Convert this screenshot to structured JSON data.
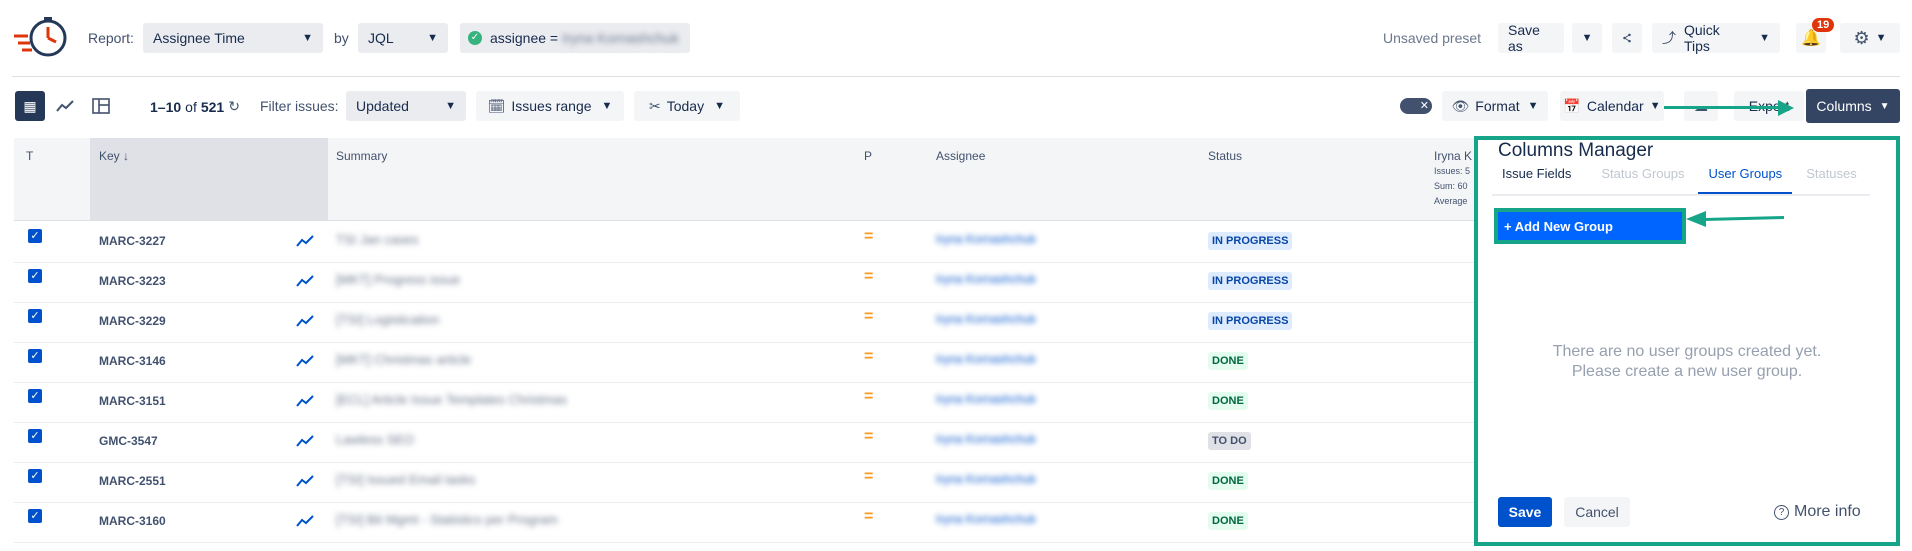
{
  "header": {
    "report_label": "Report:",
    "report_value": "Assignee Time",
    "by_label": "by",
    "by_value": "JQL",
    "filter_text": "assignee =",
    "filter_value": "Iryna Kornashchuk",
    "unsaved_preset": "Unsaved preset",
    "save_as": "Save as",
    "quick_tips": "Quick Tips",
    "notification_count": "19"
  },
  "toolbar": {
    "range_text": "1–10",
    "of_text": "of",
    "total": "521",
    "filter_issues_label": "Filter issues:",
    "filter_value": "Updated",
    "issues_range": "Issues range",
    "today": "Today",
    "format": "Format",
    "calendar": "Calendar",
    "export": "Export",
    "columns": "Columns"
  },
  "table": {
    "headers": {
      "t": "T",
      "key": "Key",
      "summary": "Summary",
      "p": "P",
      "assignee": "Assignee",
      "status": "Status"
    },
    "extra_col": {
      "name": "Iryna K",
      "issues": "Issues: 5",
      "sum": "Sum: 60",
      "average": "Average"
    },
    "rows": [
      {
        "key": "MARC-3227",
        "summary": "TSI Jan cases",
        "assignee": "Iryna Kornashchuk",
        "status": "IN PROGRESS",
        "status_kind": "prog"
      },
      {
        "key": "MARC-3223",
        "summary": "[MKT] Progress issue",
        "assignee": "Iryna Kornashchuk",
        "status": "IN PROGRESS",
        "status_kind": "prog"
      },
      {
        "key": "MARC-3229",
        "summary": "[TSI] Logistication",
        "assignee": "Iryna Kornashchuk",
        "status": "IN PROGRESS",
        "status_kind": "prog"
      },
      {
        "key": "MARC-3146",
        "summary": "[MKT] Christmas article",
        "assignee": "Iryna Kornashchuk",
        "status": "DONE",
        "status_kind": "done"
      },
      {
        "key": "MARC-3151",
        "summary": "[ECL] Article Issue Templates Christmas",
        "assignee": "Iryna Kornashchuk",
        "status": "DONE",
        "status_kind": "done"
      },
      {
        "key": "GMC-3547",
        "summary": "Lawless SEO",
        "assignee": "Iryna Kornashchuk",
        "status": "TO DO",
        "status_kind": "todo"
      },
      {
        "key": "MARC-2551",
        "summary": "[TSI] Issued Email tasks",
        "assignee": "Iryna Kornashchuk",
        "status": "DONE",
        "status_kind": "done"
      },
      {
        "key": "MARC-3160",
        "summary": "[TSI] Bit Mgmt - Statistics per Program",
        "assignee": "Iryna Kornashchuk",
        "status": "DONE",
        "status_kind": "done"
      }
    ]
  },
  "columns_manager": {
    "title": "Columns Manager",
    "tabs": [
      "Issue Fields",
      "Status Groups",
      "User Groups",
      "Statuses"
    ],
    "add_group": "+ Add New Group",
    "empty_line1": "There are no user groups created yet.",
    "empty_line2": "Please create a new user group.",
    "save": "Save",
    "cancel": "Cancel",
    "more_info": "More info"
  },
  "colors": {
    "accent": "#0052cc",
    "highlight": "#17a589",
    "dark_button": "#344563",
    "badge": "#de350b"
  }
}
